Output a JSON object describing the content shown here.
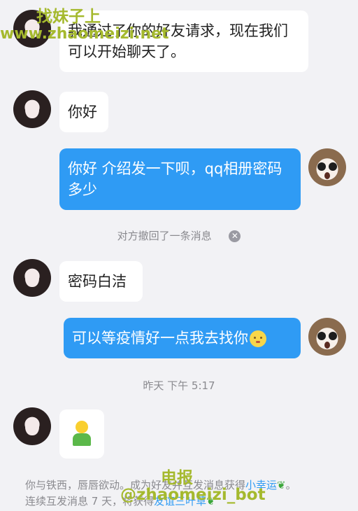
{
  "messages": [
    {
      "side": "in",
      "text": "我通过了你的好友请求，现在我们可以开始聊天了。"
    },
    {
      "side": "in",
      "text": "你好"
    },
    {
      "side": "out",
      "text": "你好 介绍发一下呗，qq相册密码多少"
    },
    {
      "side": "in",
      "text": "密码白洁"
    },
    {
      "side": "out",
      "text": "可以等疫情好一点我去找你"
    }
  ],
  "notices": {
    "recall": "对方撤回了一条消息",
    "timestamp": "昨天 下午 5:17"
  },
  "footer": {
    "line1_pre": "你与铁西，唇唇欲动。成为好友并互发消息获得",
    "line1_link": "小幸运",
    "line1_end": "。",
    "line2_pre": "连续互发消息 7 天，将获得",
    "line2_link": "友谊三叶草"
  },
  "watermarks": {
    "top1": "找妹子上",
    "top2": "www.zhaomeizi.net",
    "bottom1": "电报",
    "bottom2": "@zhaomeizi_bot"
  },
  "icons": {
    "avatar_contact": "girl-portrait",
    "avatar_self": "cat-face",
    "recall_close": "close-circle-icon",
    "emoji": "pensive-face-emoji",
    "sticker": "yellow-figure-sticker",
    "sprout": "sprout-icon"
  },
  "colors": {
    "background": "#f2f2f5",
    "bubble_in": "#ffffff",
    "bubble_out": "#2f9bf4",
    "link": "#2f9bf4",
    "muted_text": "#8a8a8f",
    "watermark": "#a5b92e"
  }
}
